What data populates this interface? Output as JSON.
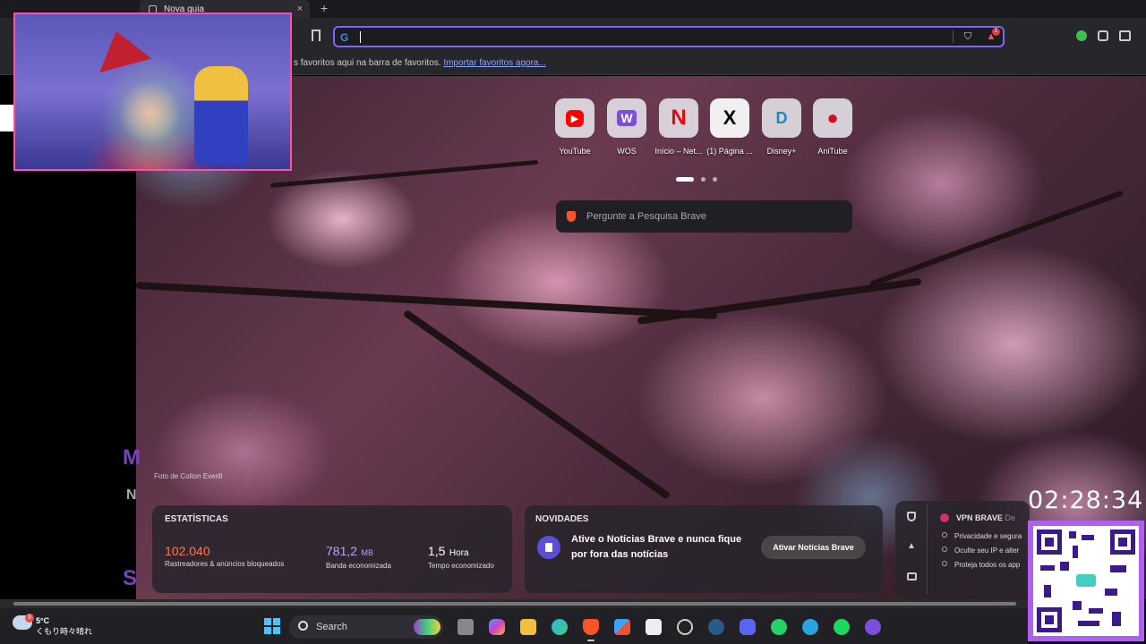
{
  "browser": {
    "tab_title": "Nova guia",
    "tab_close": "×",
    "new_tab": "+",
    "bookmark_bar_text": "s favoritos aqui na barra de favoritos.",
    "bookmark_bar_link": "Importar favoritos agora...",
    "search_engine_glyph": "G",
    "notification_badge": "1"
  },
  "top_sites": [
    {
      "label": "YouTube",
      "glyph": "▶",
      "color": "#ff0000"
    },
    {
      "label": "WOS",
      "glyph": "W",
      "color": "#7b4fd9"
    },
    {
      "label": "Início – Net...",
      "glyph": "N",
      "color": "#e50914"
    },
    {
      "label": "(1) Página ...",
      "glyph": "X",
      "color": "#000000"
    },
    {
      "label": "Disney+",
      "glyph": "D",
      "color": "#1a8bbf"
    },
    {
      "label": "AniTube",
      "glyph": "●",
      "color": "#d01020"
    }
  ],
  "search_box_placeholder": "Pergunte a Pesquisa Brave",
  "photo_credit": "Foto de Colton Everill",
  "stats": {
    "title": "ESTATÍSTICAS",
    "items": [
      {
        "value": "102.040",
        "unit": "",
        "label": "Rastreadores & anúncios bloqueados",
        "color": "#ff7a4f"
      },
      {
        "value": "781,2",
        "unit": "MB",
        "label": "Banda economizada",
        "color": "#b9a4ff"
      },
      {
        "value": "1,5",
        "unit": "Hora",
        "label": "Tempo economizado",
        "color": "#ffffff"
      }
    ]
  },
  "news": {
    "title": "NOVIDADES",
    "message": "Ative o Notícias Brave e nunca fique por fora das notícias",
    "button": "Ativar Notícias Brave"
  },
  "vpn": {
    "title": "VPN BRAVE",
    "title_suffix": "De",
    "items": [
      "Privacidade e segura",
      "Oculte seu IP e alter",
      "Proteja todos os app"
    ]
  },
  "overlay": {
    "clock": "02:28:34",
    "ghost_letters": [
      "M",
      "N",
      "S"
    ]
  },
  "taskbar": {
    "temperature": "5°C",
    "weather_desc": "くもり時々晴れ",
    "weather_badge": "3",
    "search_placeholder": "Search"
  }
}
